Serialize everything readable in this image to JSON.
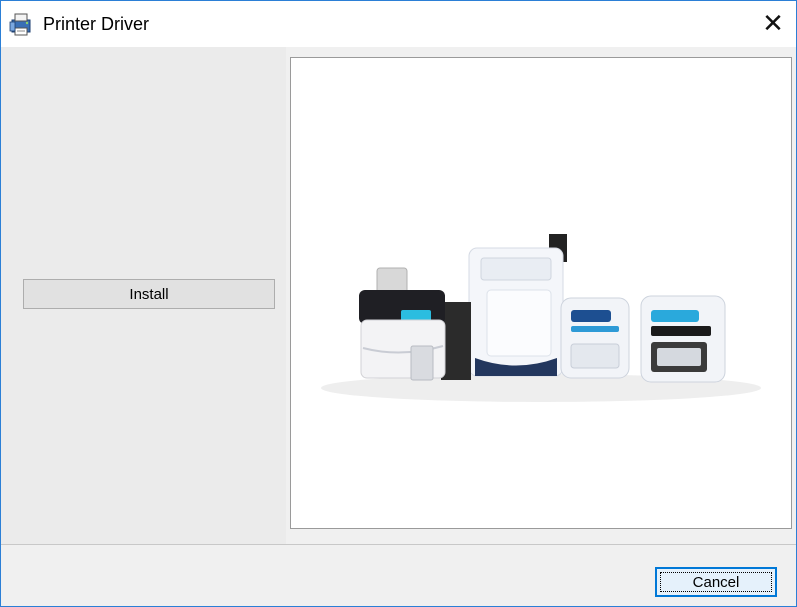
{
  "window": {
    "title": "Printer Driver",
    "icon": "printer-driver-app-icon",
    "close_icon": "close-icon"
  },
  "left_panel": {
    "install_label": "Install"
  },
  "image": {
    "description_icon": "card-printers-product-image"
  },
  "footer": {
    "cancel_label": "Cancel"
  },
  "colors": {
    "window_border": "#2b7fd6",
    "dialog_bg": "#f0f0f0",
    "focus_border": "#0078d7"
  }
}
